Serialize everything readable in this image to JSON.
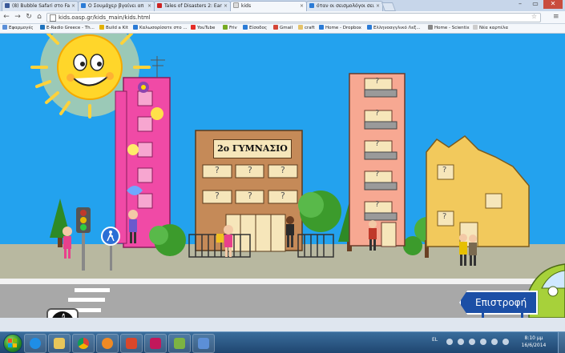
{
  "browser": {
    "tabs": [
      {
        "title": "(8) Bubble Safari στο Face",
        "icon_color": "#3b5998",
        "active": false
      },
      {
        "title": "Ο Σουμάχερ βγαίνει απ",
        "icon_color": "#2b7bd6",
        "active": false
      },
      {
        "title": "Tales of Disasters 2: Earth",
        "icon_color": "#cc2222",
        "active": false
      },
      {
        "title": "kids",
        "icon_color": "#dddddd",
        "active": true
      },
      {
        "title": "όταν οι σεισμολόγοι σεισ",
        "icon_color": "#2b7bd6",
        "active": false
      }
    ],
    "url": "kids.oasp.gr/kids_main/kids.html",
    "bookmarks": [
      {
        "label": "Εφαρμογές",
        "icon_color": "#5b8fd8"
      },
      {
        "label": "E-Radio Greece - Th...",
        "icon_color": "#1e73be"
      },
      {
        "label": "Build a Kit",
        "icon_color": "#e2b100"
      },
      {
        "label": "Καλωσορίσατε στο ...",
        "icon_color": "#2b7bd6"
      },
      {
        "label": "YouTube",
        "icon_color": "#e52d27"
      },
      {
        "label": "Friv",
        "icon_color": "#77aa22"
      },
      {
        "label": "Είσοδος",
        "icon_color": "#2b7bd6"
      },
      {
        "label": "Gmail",
        "icon_color": "#d44638"
      },
      {
        "label": "craft",
        "icon_color": "#e5c36a"
      },
      {
        "label": "Home - Dropbox",
        "icon_color": "#2b7bd6"
      },
      {
        "label": "Ελληνοαγγλικό Λεξ...",
        "icon_color": "#2b7bd6"
      },
      {
        "label": "Home - Scientix",
        "icon_color": "#888888"
      },
      {
        "label": "Νέα καρτέλα",
        "icon_color": "#cccccc"
      }
    ]
  },
  "page": {
    "school_sign": "2ο ΓΥΜΝΑΣΙΟ",
    "back_label": "Επιστροφή",
    "music_symbol": "𝄞",
    "question_mark": "?"
  },
  "taskbar": {
    "language": "EL",
    "time": "8:10 μμ",
    "date": "16/6/2014",
    "apps": [
      {
        "name": "internet-explorer",
        "color": "#1f8ee6"
      },
      {
        "name": "file-explorer",
        "color": "#e8c65a"
      },
      {
        "name": "chrome",
        "color": "#4caf50"
      },
      {
        "name": "media-player",
        "color": "#f08a24"
      },
      {
        "name": "presentation",
        "color": "#d9472b"
      },
      {
        "name": "photos",
        "color": "#c2185b"
      },
      {
        "name": "downloads",
        "color": "#7cb342"
      },
      {
        "name": "remote-desktop",
        "color": "#5c8fd6"
      }
    ]
  }
}
